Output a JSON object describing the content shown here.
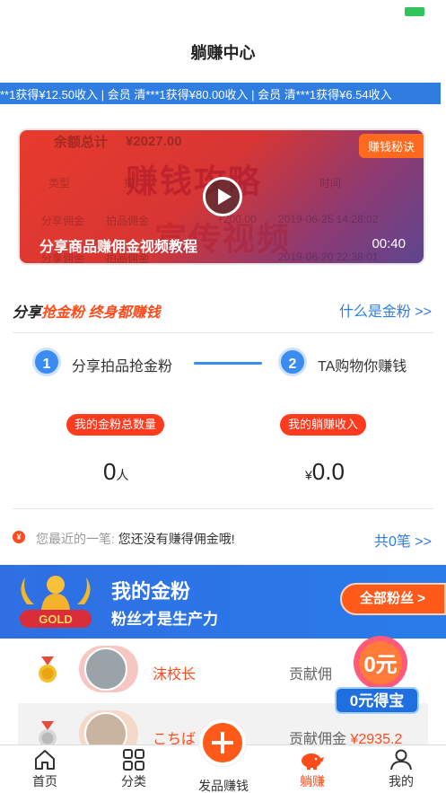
{
  "nav": {
    "title": "躺赚中心"
  },
  "ticker": {
    "text": "**1获得¥12.50收入 | 会员 清***1获得¥80.00收入 | 会员 清***1获得¥6.54收入"
  },
  "video": {
    "bg_label_total": "余额总计",
    "bg_total_amount": "¥2027.00",
    "bg_col_type": "类型",
    "bg_col_desc": "描",
    "bg_col_time": "时间",
    "bg_row1_type": "分享佣金",
    "bg_row1_desc": "拍品佣金",
    "bg_row1_amount": "+200.00",
    "bg_row1_time": "2019-06-25 14:28:02",
    "bg_row2_type": "分享佣金",
    "bg_row2_desc": "拍品佣金",
    "bg_row2_time": "2019-06-20 22:38:01",
    "bg_big_text": "赚钱攻略",
    "bg_big_text2": "宣传视频",
    "badge": "赚钱秘诀",
    "caption": "分享商品赚佣金视频教程",
    "duration": "00:40"
  },
  "share": {
    "title_prefix": "分享",
    "title_highlight": "抢金粉 终身都赚钱",
    "link": "什么是金粉 >>"
  },
  "steps": [
    {
      "num": "1",
      "label": "分享拍品抢金粉"
    },
    {
      "num": "2",
      "label": "TA购物你赚钱"
    }
  ],
  "stats": {
    "fans_label": "我的金粉总数量",
    "fans_value": "0",
    "fans_unit": "人",
    "income_label": "我的躺赚收入",
    "income_currency": "¥",
    "income_value": "0.0"
  },
  "recent": {
    "icon": "¥",
    "label": "您最近的一笔:",
    "message": "您还没有赚得佣金哦!",
    "count": "共0笔 >>"
  },
  "fans_banner": {
    "gold_text": "GOLD",
    "title": "我的金粉",
    "subtitle": "粉丝才是生产力",
    "button": "全部粉丝 >"
  },
  "fans": [
    {
      "rank_icon": "medal-gold-icon",
      "name": "沫校长",
      "contrib_label": "贡献佣",
      "amount": ""
    },
    {
      "rank_icon": "medal-silver-icon",
      "name": "こちば",
      "contrib_label": "贡献佣金",
      "amount": "¥2935.2"
    }
  ],
  "promo": {
    "top_text": "0元",
    "bottom_text": "0元得宝"
  },
  "tabs": [
    {
      "label": "首页",
      "icon": "home-icon"
    },
    {
      "label": "分类",
      "icon": "category-icon"
    },
    {
      "label": "发品赚钱",
      "icon": "plus-icon"
    },
    {
      "label": "躺赚",
      "icon": "piggy-bank-icon",
      "active": true
    },
    {
      "label": "我的",
      "icon": "user-icon"
    }
  ],
  "colors": {
    "accent": "#ff4a1a",
    "blue": "#2f7de1",
    "banner_blue": "#2f6fe3"
  }
}
